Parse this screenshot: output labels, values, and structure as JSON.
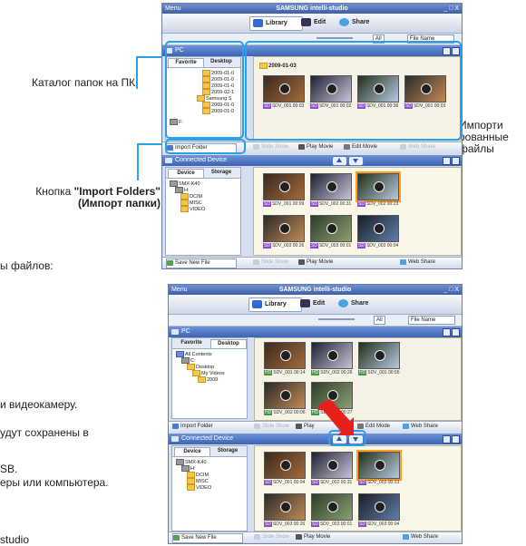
{
  "background_text": {
    "line1": "ы файлов:",
    "line2": "и видеокамеру.",
    "line3": "удут сохранены в",
    "line4": "SB.",
    "line5": "еры или компьютера.",
    "line6": "studio"
  },
  "annotations": {
    "pc_catalog": "Каталог папок на ПК",
    "import_button_prefix": "Кнопка ",
    "import_button_bold1": "\"Import Folders\"",
    "import_button_bold2": "(Импорт папки)",
    "imported_files": [
      "Импорти",
      "рованные",
      "файлы"
    ]
  },
  "app": {
    "menu": "Menu",
    "brand": "SAMSUNG intelli-studio",
    "window_controls": "_ □ X",
    "tabs": [
      {
        "label": "Library",
        "icon": "library-icon"
      },
      {
        "label": "Edit",
        "icon": "edit-icon"
      },
      {
        "label": "Share",
        "icon": "share-icon"
      }
    ],
    "toolbar": {
      "view_all": "All",
      "sort_option": "File Name"
    },
    "pc_panel": {
      "title": "PC"
    },
    "device_panel": {
      "title": "Connected Device"
    }
  },
  "shot1": {
    "tree_tabs": [
      "Favorite",
      "Desktop"
    ],
    "tree_nodes": [
      "2009-01-0",
      "2009-01-0",
      "2009-01-0",
      "2009-02-1",
      "Samsung S",
      "2009-01-0",
      "2009-01-0",
      "F:"
    ],
    "date_group": "2009-01-03",
    "pc_thumbs": [
      {
        "name": "SDV_001",
        "time": "00:03"
      },
      {
        "name": "SDV_001",
        "time": "00:02"
      },
      {
        "name": "SDV_001",
        "time": "00:36"
      },
      {
        "name": "SDV_001",
        "time": "00:03"
      }
    ],
    "pc_bar": {
      "import": "Import Folder",
      "slide": "Slide Show",
      "play": "Play Movie",
      "edit": "Edit Movie",
      "web": "Web Share"
    },
    "device_tabs": [
      "Device",
      "Storage"
    ],
    "device_tree": [
      "SMX-K40",
      "H:",
      "DCIM",
      "MISC",
      "VIDEO"
    ],
    "device_thumbs": [
      {
        "name": "SDV_001",
        "time": "00:09"
      },
      {
        "name": "SDV_002",
        "time": "00:31"
      },
      {
        "name": "SDV_002",
        "time": "00:23"
      },
      {
        "name": "SDV_003",
        "time": "00:26"
      },
      {
        "name": "SDV_003",
        "time": "00:01"
      },
      {
        "name": "SDV_003",
        "time": "00:04"
      }
    ],
    "device_bar": {
      "save": "Save New File",
      "slide": "Slide Show",
      "play": "Play Movie",
      "web": "Web Share"
    }
  },
  "shot2": {
    "tree_tabs": [
      "Favorite",
      "Desktop"
    ],
    "tree_nodes": [
      "All Contents",
      "C:",
      "Desktop",
      "My Videos",
      "2009"
    ],
    "pc_thumbs": [
      {
        "name": "SDV_001",
        "time": "00:14"
      },
      {
        "name": "SDV_002",
        "time": "00:26"
      },
      {
        "name": "SDV_001",
        "time": "00:55"
      },
      {
        "name": "SDV_002",
        "time": "00:06"
      },
      {
        "name": "SDV_003",
        "time": "00:27"
      }
    ],
    "pc_bar": {
      "import": "Import Folder",
      "slide": "Slide Show",
      "play": "Play",
      "edit": "Edit Mode",
      "web": "Web Share"
    },
    "device_tabs": [
      "Device",
      "Storage"
    ],
    "device_tree": [
      "SMX-K40",
      "H:",
      "DCIM",
      "MISC",
      "VIDEO"
    ],
    "device_thumbs": [
      {
        "name": "SDV_001",
        "time": "00:04"
      },
      {
        "name": "SDV_002",
        "time": "00:31"
      },
      {
        "name": "SDV_002",
        "time": "00:23"
      },
      {
        "name": "SDV_003",
        "time": "00:26"
      },
      {
        "name": "SDV_003",
        "time": "00:01"
      },
      {
        "name": "SDV_003",
        "time": "00:04"
      }
    ],
    "device_bar": {
      "save": "Save New File",
      "slide": "Slide Show",
      "play": "Play Movie",
      "web": "Web Share"
    }
  },
  "colors": {
    "callout": "#2aa0e8",
    "arrow": "#e8201c",
    "selection": "#ff9e1e"
  }
}
